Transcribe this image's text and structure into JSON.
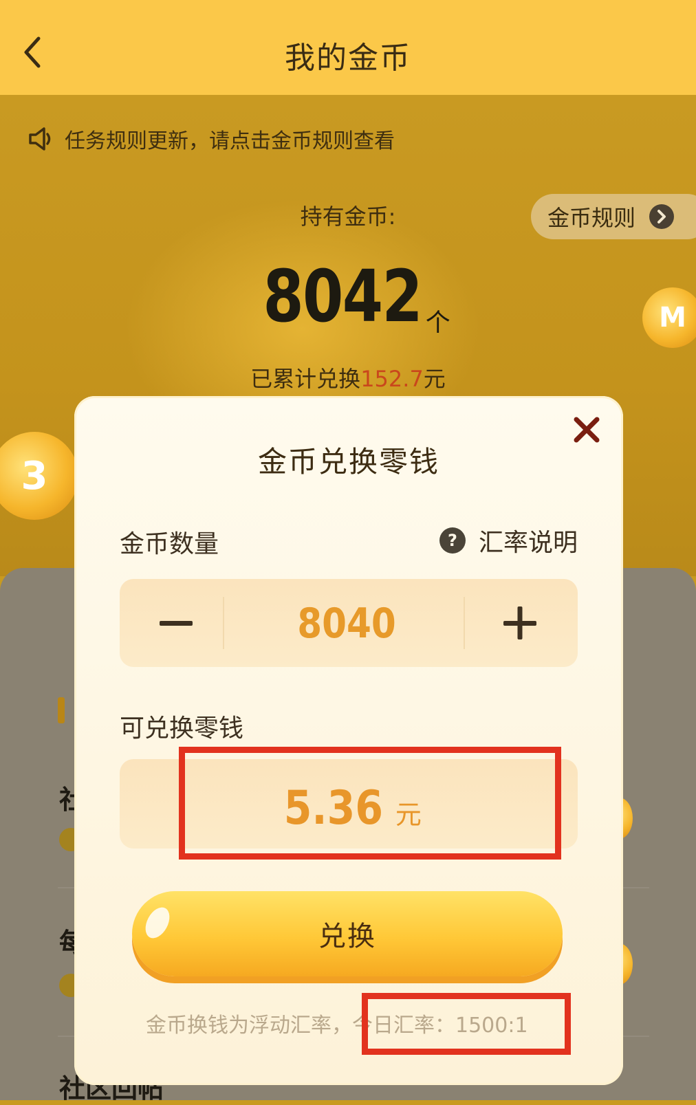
{
  "header": {
    "title": "我的金币"
  },
  "notice": {
    "text": "任务规则更新，请点击金币规则查看"
  },
  "coins": {
    "held_label": "持有金币:",
    "balance": "8042",
    "balance_unit": "个",
    "rules_button": "金币规则",
    "cumulative_prefix": "已累计兑换",
    "cumulative_amount": "152.7",
    "cumulative_suffix": "元"
  },
  "lower": {
    "items": [
      "社",
      "每",
      "社区回帖"
    ]
  },
  "modal": {
    "title": "金币兑换零钱",
    "quantity_label": "金币数量",
    "rate_info_label": "汇率说明",
    "quantity_value": "8040",
    "change_label": "可兑换零钱",
    "change_amount": "5.36",
    "change_unit": "元",
    "exchange_button": "兑换",
    "rate_note_prefix": "金币换钱为浮动汇率，",
    "rate_note_today": "今日汇率：1500:1"
  },
  "colors": {
    "header_bg": "#fbc849",
    "accent_orange": "#e8962a",
    "highlight_red": "#e2321e",
    "amount_red": "#c9471c"
  }
}
